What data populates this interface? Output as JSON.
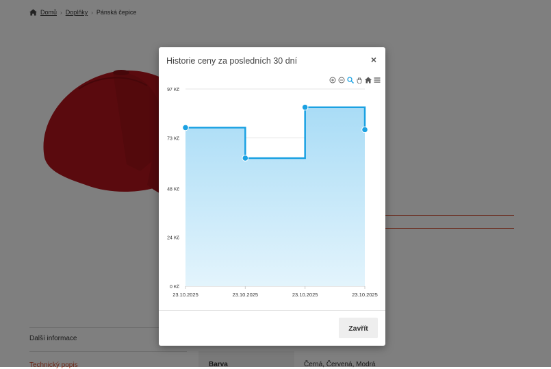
{
  "breadcrumb": {
    "home": "Domů",
    "category": "Doplňky",
    "current": "Pánská čepice",
    "separator": "›"
  },
  "product_tabs": {
    "tab1": "Další informace",
    "tab2": "Technický popis"
  },
  "attributes": {
    "label": "Barva",
    "value": "Černá, Červená, Modrá"
  },
  "modal": {
    "title": "Historie ceny za posledních 30 dní",
    "close_icon": "×",
    "close_button": "Zavřít"
  },
  "toolbar": {
    "icons": [
      "zoom-in-icon",
      "zoom-out-icon",
      "magnifier-icon",
      "pan-hand-icon",
      "home-reset-icon",
      "menu-icon"
    ]
  },
  "colors": {
    "accent": "#1ba1e2",
    "area_top": "#a9dcf6",
    "area_bottom": "#e3f4fc",
    "product_red": "#b4141c",
    "link_orange": "#d24b2c"
  },
  "chart_data": {
    "type": "area",
    "step": true,
    "x_labels": [
      "23.10.2025",
      "23.10.2025",
      "23.10.2025",
      "23.10.2025"
    ],
    "points": [
      {
        "x": 0,
        "y": 78
      },
      {
        "x": 1,
        "y": 63
      },
      {
        "x": 2,
        "y": 88
      },
      {
        "x": 3,
        "y": 77
      }
    ],
    "y_ticks": [
      "0 Kč",
      "24 Kč",
      "48 Kč",
      "73 Kč",
      "97 Kč"
    ],
    "y_tick_values": [
      0,
      24,
      48,
      73,
      97
    ],
    "ylim": [
      0,
      97
    ],
    "grid": true
  }
}
